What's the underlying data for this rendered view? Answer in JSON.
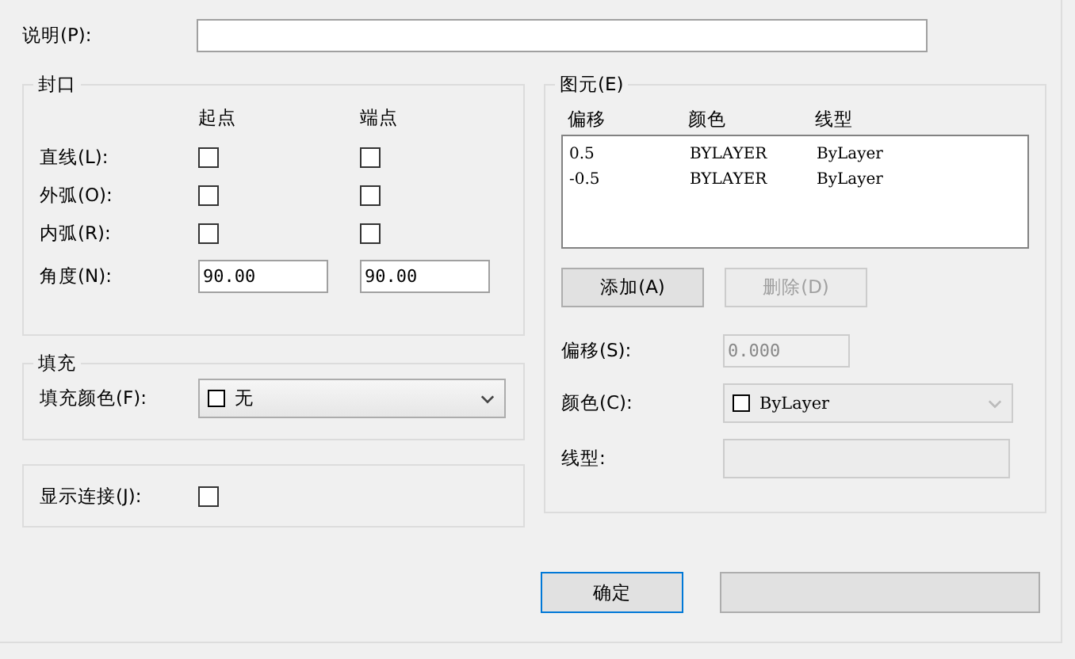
{
  "description": {
    "label": "说明(P):"
  },
  "caps": {
    "title": "封口",
    "col_start": "起点",
    "col_end": "端点",
    "rows": [
      {
        "kind": "check",
        "label": "直线(L):",
        "start_checked": false,
        "end_checked": false
      },
      {
        "kind": "check",
        "label": "外弧(O):",
        "start_checked": false,
        "end_checked": false
      },
      {
        "kind": "check",
        "label": "内弧(R):",
        "start_checked": false,
        "end_checked": false
      },
      {
        "kind": "input",
        "label": "角度(N):",
        "start_value": "90.00",
        "end_value": "90.00"
      }
    ]
  },
  "fill": {
    "title": "填充",
    "label": "填充颜色(F):",
    "value": "无"
  },
  "joints": {
    "label": "显示连接(J):",
    "checked": false
  },
  "elements": {
    "title": "图元(E)",
    "columns": [
      "偏移",
      "颜色",
      "线型"
    ],
    "rows": [
      {
        "cells": [
          "0.5",
          "BYLAYER",
          "ByLayer"
        ],
        "selected": false
      },
      {
        "cells": [
          "-0.5",
          "BYLAYER",
          "ByLayer"
        ],
        "selected": false
      }
    ],
    "add_button": {
      "label": "添加(A)",
      "disabled": false
    },
    "delete_button": {
      "label": "删除(D)",
      "disabled": true
    },
    "offset": {
      "label": "偏移(S):",
      "value": "0.000",
      "disabled": true
    },
    "color": {
      "label": "颜色(C):",
      "value": "ByLayer",
      "disabled": true
    },
    "linetype": {
      "label": "线型:",
      "disabled": true
    }
  },
  "buttons": [
    {
      "label": "确定",
      "kind": "ok"
    },
    {
      "kind": "cancel"
    }
  ]
}
